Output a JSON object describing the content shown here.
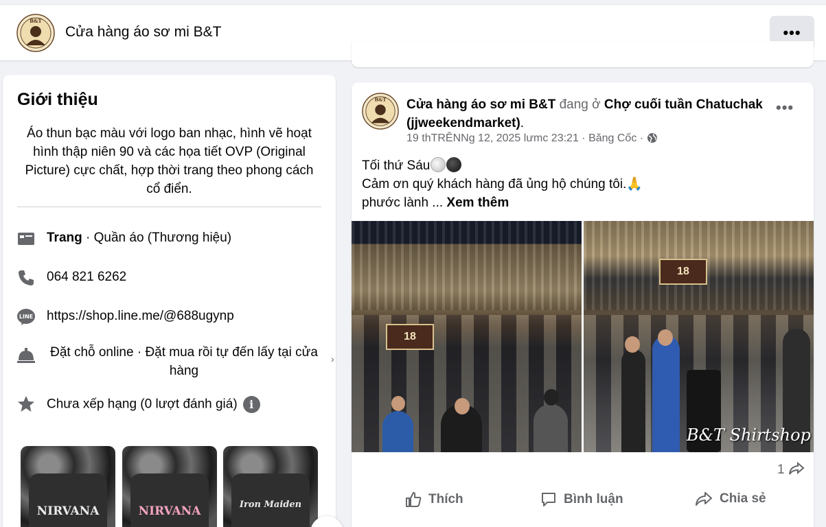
{
  "header": {
    "page_name": "Cửa hàng áo sơ mi B&T",
    "avatar_label": "B&T SHIRT SHOP",
    "more_label": "•••"
  },
  "intro": {
    "title": "Giới thiệu",
    "bio": "Áo thun bạc màu với logo ban nhạc, hình vẽ hoạt hình thập niên 90 và các họa tiết OVP (Original Picture) cực chất, hợp thời trang theo phong cách cổ điển.",
    "category_label": "Trang",
    "category_value": " · Quần áo (Thương hiệu)",
    "phone": "064 821 6262",
    "website": "https://shop.line.me/@688ugynp",
    "booking": "Đặt chỗ online · Đặt mua rồi tự đến lấy tại cửa hàng",
    "rating": "Chưa xếp hạng (0 lượt đánh giá)",
    "rating_info_icon": "i",
    "photos": [
      {
        "caption": "NIRVANA"
      },
      {
        "caption": "NIRVANA"
      },
      {
        "caption": "Iron Maiden"
      }
    ]
  },
  "post": {
    "author": "Cửa hàng áo sơ mi B&T",
    "at_text": " đang ở ",
    "location": "Chợ cuối tuần Chatuchak (jjweekendmarket)",
    "location_end": ".",
    "meta": "19 thTRÊNNg 12, 2025 lưmc 23:21 · Băng Cốc · ",
    "more_label": "•••",
    "line1": "Tối thứ Sáu",
    "line2": "Cảm ơn quý khách hàng đã ủng hộ chúng tôi.🙏",
    "line3": "phước lành ... ",
    "see_more": "Xem thêm",
    "image_watermark": "B&T Shirtshop",
    "sign_left": "18",
    "sign_right": "18",
    "share_count": "1",
    "actions": {
      "like": "Thích",
      "comment": "Bình luận",
      "share": "Chia sẻ"
    }
  },
  "icons": {
    "category": "storefront-icon",
    "phone": "phone-icon",
    "website": "line-icon",
    "booking": "bell-icon",
    "rating": "star-icon",
    "privacy": "globe-icon"
  }
}
